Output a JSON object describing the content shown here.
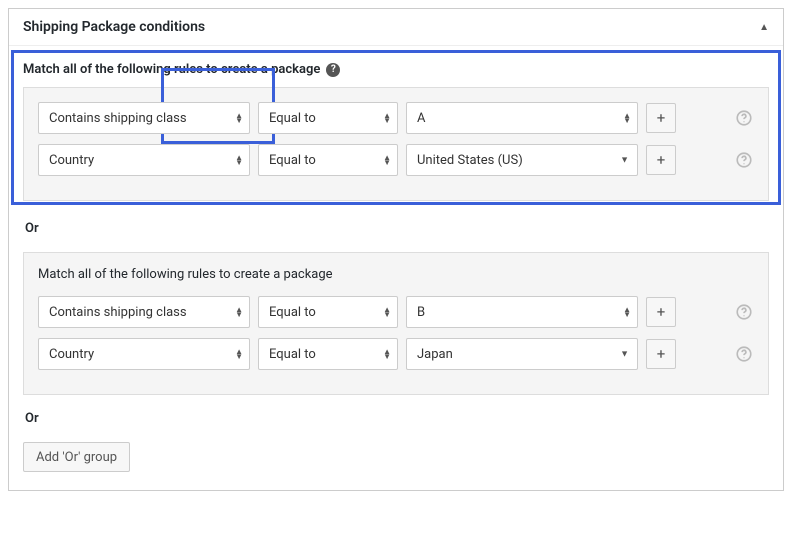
{
  "header": {
    "title": "Shipping Package conditions"
  },
  "group1": {
    "label": "Match all of the following rules to create a package",
    "rows": [
      {
        "subject": "Contains shipping class",
        "operator": "Equal to",
        "value": "A",
        "valueHasDropdown": false
      },
      {
        "subject": "Country",
        "operator": "Equal to",
        "value": "United States (US)",
        "valueHasDropdown": true
      }
    ]
  },
  "or_label": "Or",
  "group2": {
    "label": "Match all of the following rules to create a package",
    "rows": [
      {
        "subject": "Contains shipping class",
        "operator": "Equal to",
        "value": "B",
        "valueHasDropdown": false
      },
      {
        "subject": "Country",
        "operator": "Equal to",
        "value": "Japan",
        "valueHasDropdown": true
      }
    ]
  },
  "add_or_group": "Add 'Or' group",
  "plus": "+"
}
